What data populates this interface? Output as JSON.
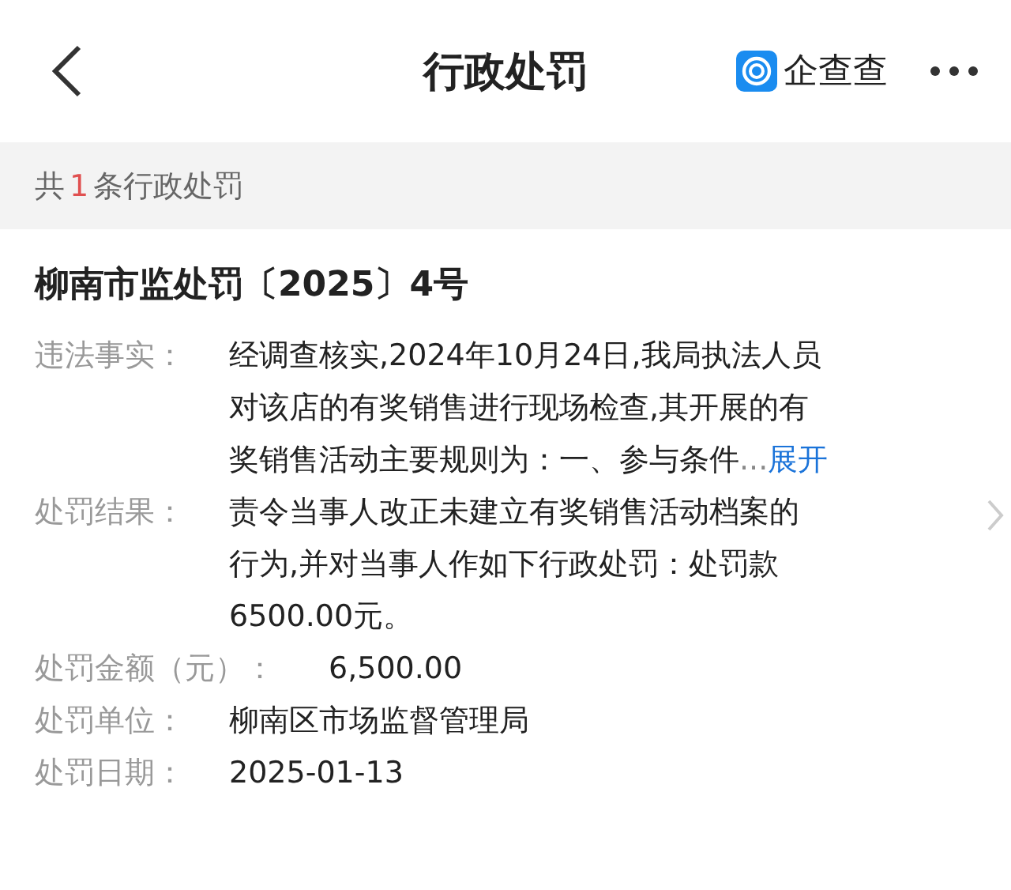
{
  "header": {
    "title": "行政处罚",
    "brand": "企查查"
  },
  "summary": {
    "prefix": "共",
    "count": "1",
    "suffix": "条行政处罚"
  },
  "record": {
    "title": "柳南市监处罚〔2025〕4号",
    "fields": [
      {
        "kind": "expandable",
        "label": "违法事实：",
        "lines": [
          "经调查核实,2024年10月24日,我局执法人员",
          "对该店的有奖销售进行现场检查,其开展的有",
          "奖销售活动主要规则为：一、参与条件"
        ],
        "ellipsis": "...",
        "expand": "展开"
      },
      {
        "kind": "text",
        "label": "处罚结果：",
        "lines": [
          "责令当事人改正未建立有奖销售活动档案的",
          "行为,并对当事人作如下行政处罚：处罚款",
          "6500.00元。"
        ]
      },
      {
        "kind": "text",
        "label": "处罚金额（元）：",
        "lines": [
          "6,500.00"
        ]
      },
      {
        "kind": "text",
        "label": "处罚单位：",
        "lines": [
          "柳南区市场监督管理局"
        ]
      },
      {
        "kind": "text",
        "label": "处罚日期：",
        "lines": [
          "2025-01-13"
        ]
      }
    ]
  }
}
